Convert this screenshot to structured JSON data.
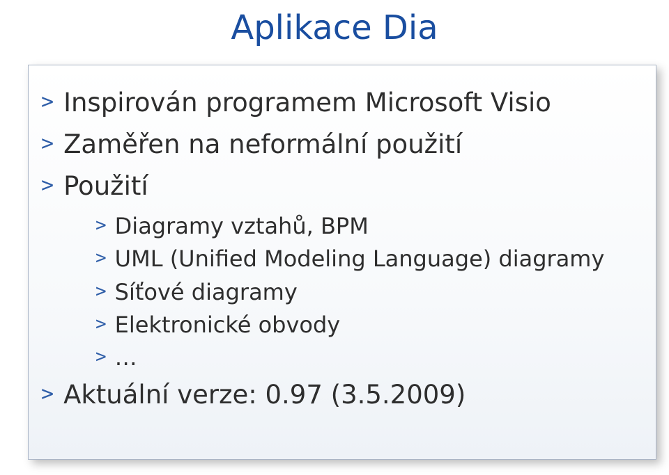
{
  "title": "Aplikace Dia",
  "bullets": {
    "b1": "Inspirován programem Microsoft Visio",
    "b2": "Zaměřen na neformální použití",
    "b3": "Použití",
    "b3_1": "Diagramy vztahů, BPM",
    "b3_2": "UML (Unified Modeling Language) diagramy",
    "b3_3": "Síťové diagramy",
    "b3_4": "Elektronické obvody",
    "b3_5": "…",
    "b4": "Aktuální verze: 0.97 (3.5.2009)"
  },
  "glyphs": {
    "bullet": ">"
  }
}
